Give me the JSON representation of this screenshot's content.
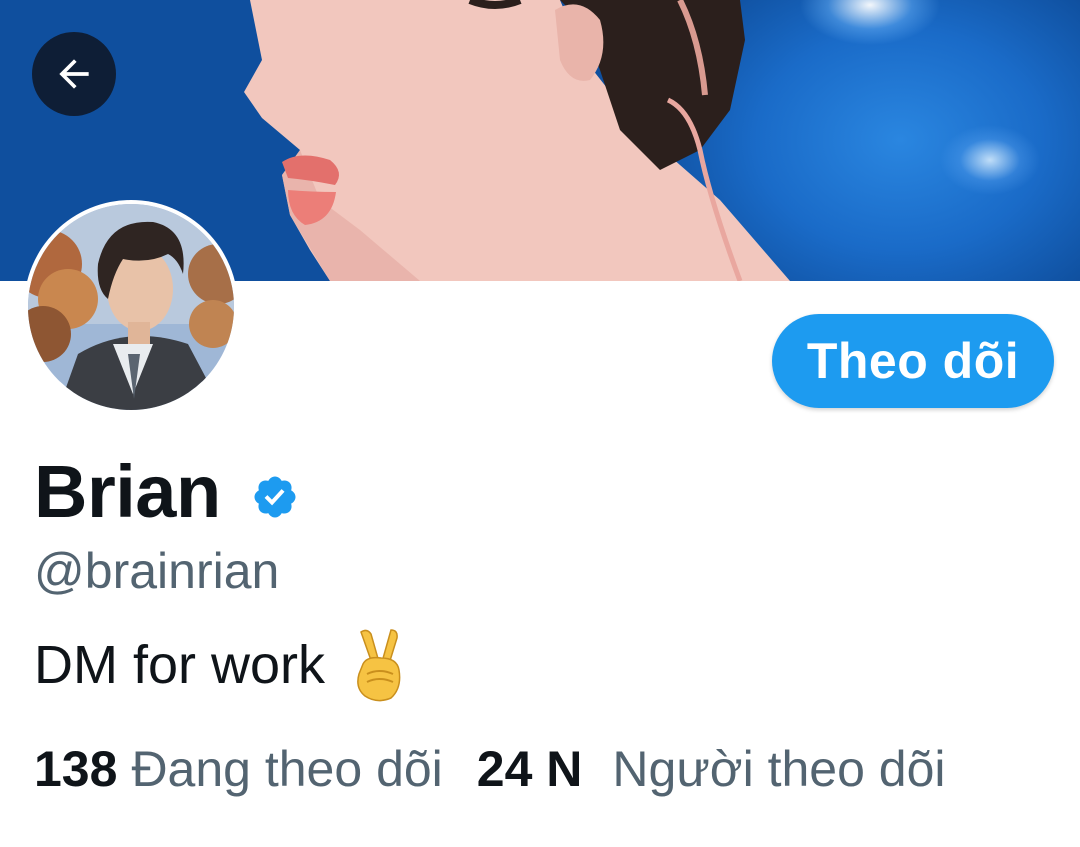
{
  "colors": {
    "accent": "#1d9bf0",
    "text_primary": "#0f1419",
    "text_secondary": "#536471",
    "banner_blue": "#1a6bc8"
  },
  "header": {
    "back_icon": "arrow-left-icon"
  },
  "profile": {
    "display_name": "Brian",
    "verified_icon": "verified-badge-icon",
    "handle": "@brainrian",
    "bio_text": "DM for work",
    "bio_emoji": "victory-hand-emoji",
    "follow_button_label": "Theo dõi"
  },
  "stats": {
    "following_count": "138",
    "following_label": "Đang theo dõi",
    "followers_count": "24 N",
    "followers_label": "Người theo dõi"
  }
}
